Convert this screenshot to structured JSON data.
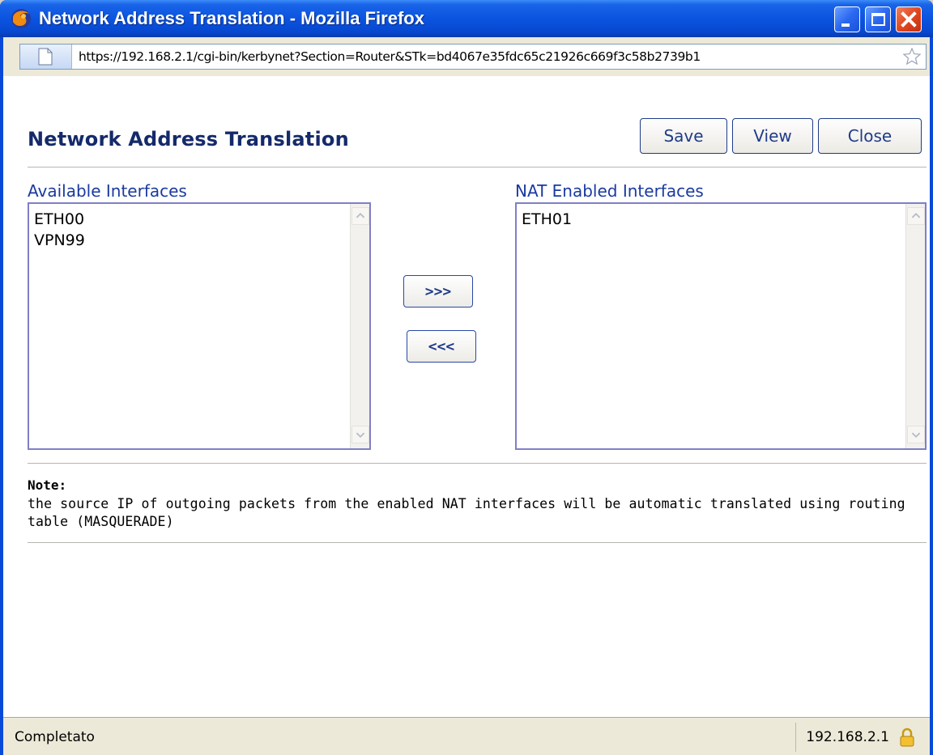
{
  "window": {
    "title": "Network Address Translation - Mozilla Firefox",
    "url": "https://192.168.2.1/cgi-bin/kerbynet?Section=Router&STk=bd4067e35fdc65c21926c669f3c58b2739b1"
  },
  "page": {
    "title": "Network Address Translation",
    "buttons": {
      "save": "Save",
      "view": "View",
      "close": "Close"
    },
    "available": {
      "label": "Available Interfaces",
      "items": [
        "ETH00",
        "VPN99"
      ]
    },
    "enabled": {
      "label": "NAT Enabled Interfaces",
      "items": [
        "ETH01"
      ]
    },
    "move": {
      "add": ">>>",
      "remove": "<<<"
    },
    "note": {
      "label": "Note:",
      "text": "the source IP of outgoing packets from the enabled NAT interfaces will be automatic translated using routing table (MASQUERADE)"
    }
  },
  "status": {
    "text": "Completato",
    "host": "192.168.2.1"
  },
  "icons": [
    "firefox-icon",
    "minimize-icon",
    "maximize-icon",
    "close-icon",
    "page-icon",
    "star-icon",
    "lock-icon",
    "scroll-up-icon",
    "scroll-down-icon"
  ]
}
